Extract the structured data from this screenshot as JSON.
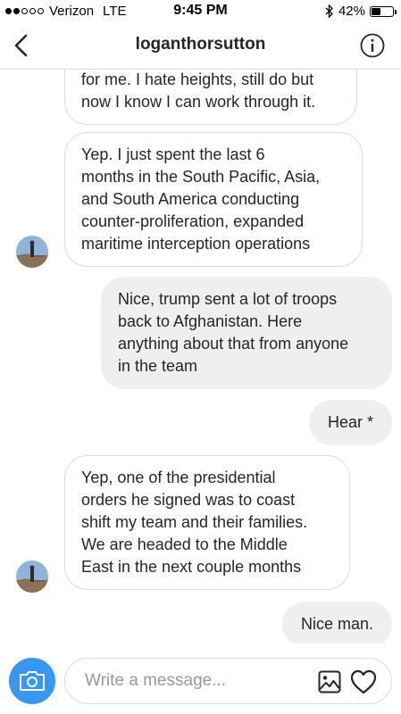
{
  "status_bar": {
    "carrier": "Verizon",
    "network": "LTE",
    "time": "9:45 PM",
    "battery_percent": "42%",
    "battery_level": 0.42,
    "signal_bars": 2
  },
  "header": {
    "title": "loganthorsutton",
    "back_icon": "chevron-left-icon",
    "info_icon": "info-circle-icon"
  },
  "messages": [
    {
      "direction": "incoming",
      "lines": [
        "for me. I hate heights, still do but",
        "now I know I can work through it."
      ]
    },
    {
      "direction": "incoming",
      "lines": [
        "Yep. I just spent the last 6",
        "months in the South Pacific, Asia,",
        "and South America conducting",
        "counter-proliferation, expanded",
        "maritime interception operations"
      ]
    },
    {
      "direction": "outgoing",
      "lines": [
        "Nice, trump sent a lot of troops",
        "back to Afghanistan. Here",
        "anything about that from anyone",
        "in the team"
      ]
    },
    {
      "direction": "outgoing",
      "lines": [
        "Hear *"
      ]
    },
    {
      "direction": "incoming",
      "lines": [
        "Yep, one of the presidential",
        "orders he signed was to coast",
        "shift my team and their families.",
        "We are headed to the Middle",
        "East in the next couple months"
      ]
    },
    {
      "direction": "outgoing",
      "lines": [
        "Nice man."
      ]
    }
  ],
  "composer": {
    "placeholder": "Write a message...",
    "camera_icon": "camera-icon",
    "gallery_icon": "gallery-icon",
    "like_icon": "heart-icon"
  },
  "colors": {
    "accent": "#3897f0",
    "outgoing_bubble": "#efefef",
    "incoming_border": "#dbdbdb"
  }
}
